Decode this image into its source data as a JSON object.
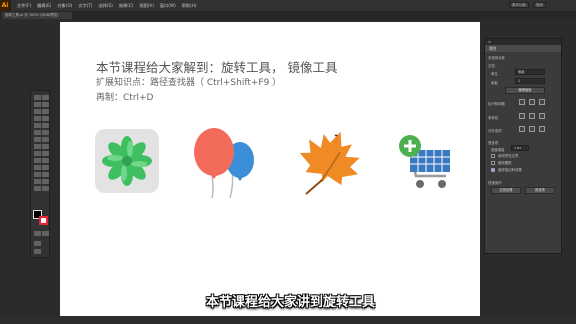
{
  "app": {
    "logo": "Ai"
  },
  "menubar": {
    "items": [
      "文件(F)",
      "编辑(E)",
      "对象(O)",
      "文字(T)",
      "选择(S)",
      "效果(C)",
      "视图(V)",
      "窗口(W)",
      "帮助(H)"
    ],
    "workspace": "基本功能",
    "search": "搜索"
  },
  "document_tab": "旋转工具.ai @ 100% (RGB/预览)",
  "canvas": {
    "title": "本节课程给大家解到：旋转工具，   镜像工具",
    "line2": "扩展知识点：路径查找器（ Ctrl+Shift+F9 ）",
    "line3": "再制：Ctrl+D",
    "icons": [
      "flower-icon",
      "balloons-icon",
      "maple-leaf-icon",
      "shopping-cart-icon"
    ]
  },
  "panel": {
    "header": "≡",
    "tab": "属性",
    "section1": "未选择对象",
    "doc_label": "文档",
    "unit_label": "单位",
    "unit_value": "像素",
    "artboard_label": "画板",
    "artboard_value": "1",
    "edit_artboard": "编辑画板",
    "ruler_label": "标尺和网格",
    "guides_label": "参考线",
    "align_label": "对齐选项",
    "prefs_label": "首选项",
    "keyboard_increment": "键盘增量",
    "keyboard_value": "1 px",
    "check1": "使用预览边界",
    "check2": "缩放圆角",
    "check3": "缩放描边和效果",
    "quick_label": "快速操作",
    "btn_doc_settings": "文档设置",
    "btn_prefs": "首选项"
  },
  "caption": "本节课程给大家讲到旋转工具",
  "colors": {
    "flower_green": "#3fbf60",
    "balloon_red": "#f26b5b",
    "balloon_blue": "#3a8fd8",
    "leaf_orange": "#f08a24",
    "cart_blue": "#3b78c4",
    "plus_green": "#4caf50"
  }
}
